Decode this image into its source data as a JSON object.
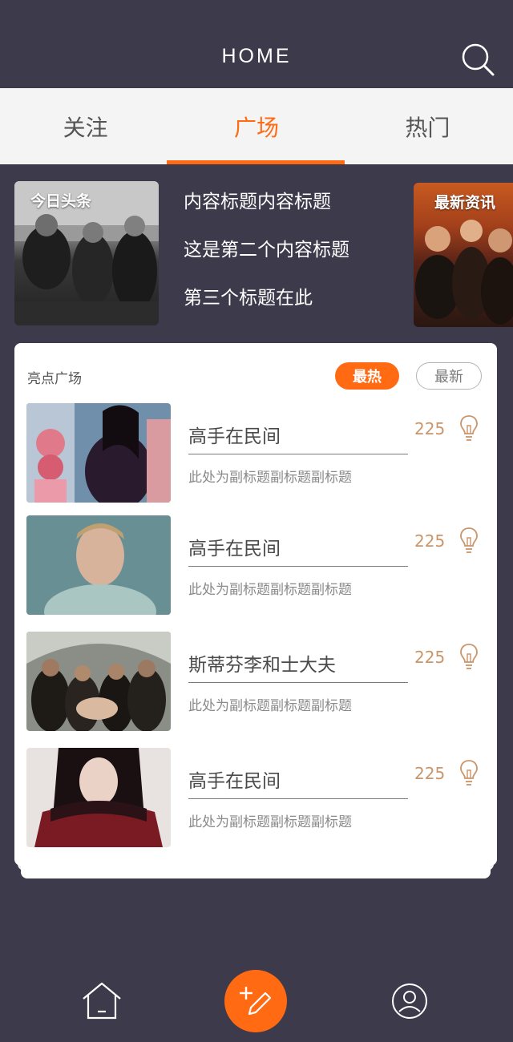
{
  "header": {
    "title": "HOME"
  },
  "tabs": [
    {
      "label": "关注"
    },
    {
      "label": "广场"
    },
    {
      "label": "热门"
    }
  ],
  "banner": {
    "left_tag": "今日头条",
    "right_tag": "最新资讯",
    "headlines": [
      "内容标题内容标题",
      "这是第二个内容标题",
      "第三个标题在此"
    ]
  },
  "card": {
    "title": "亮点广场",
    "hot_label": "最热",
    "new_label": "最新",
    "items": [
      {
        "title": "高手在民间",
        "subtitle": "此处为副标题副标题副标题",
        "count": "225"
      },
      {
        "title": "高手在民间",
        "subtitle": "此处为副标题副标题副标题",
        "count": "225"
      },
      {
        "title": "斯蒂芬李和士大夫",
        "subtitle": "此处为副标题副标题副标题",
        "count": "225"
      },
      {
        "title": "高手在民间",
        "subtitle": "此处为副标题副标题副标题",
        "count": "225"
      }
    ]
  },
  "nav": {
    "icons": [
      "home-icon",
      "add-post-icon",
      "user-icon"
    ]
  },
  "colors": {
    "accent": "#ff6a13",
    "background": "#3d3a4b",
    "count": "#c9956b"
  }
}
